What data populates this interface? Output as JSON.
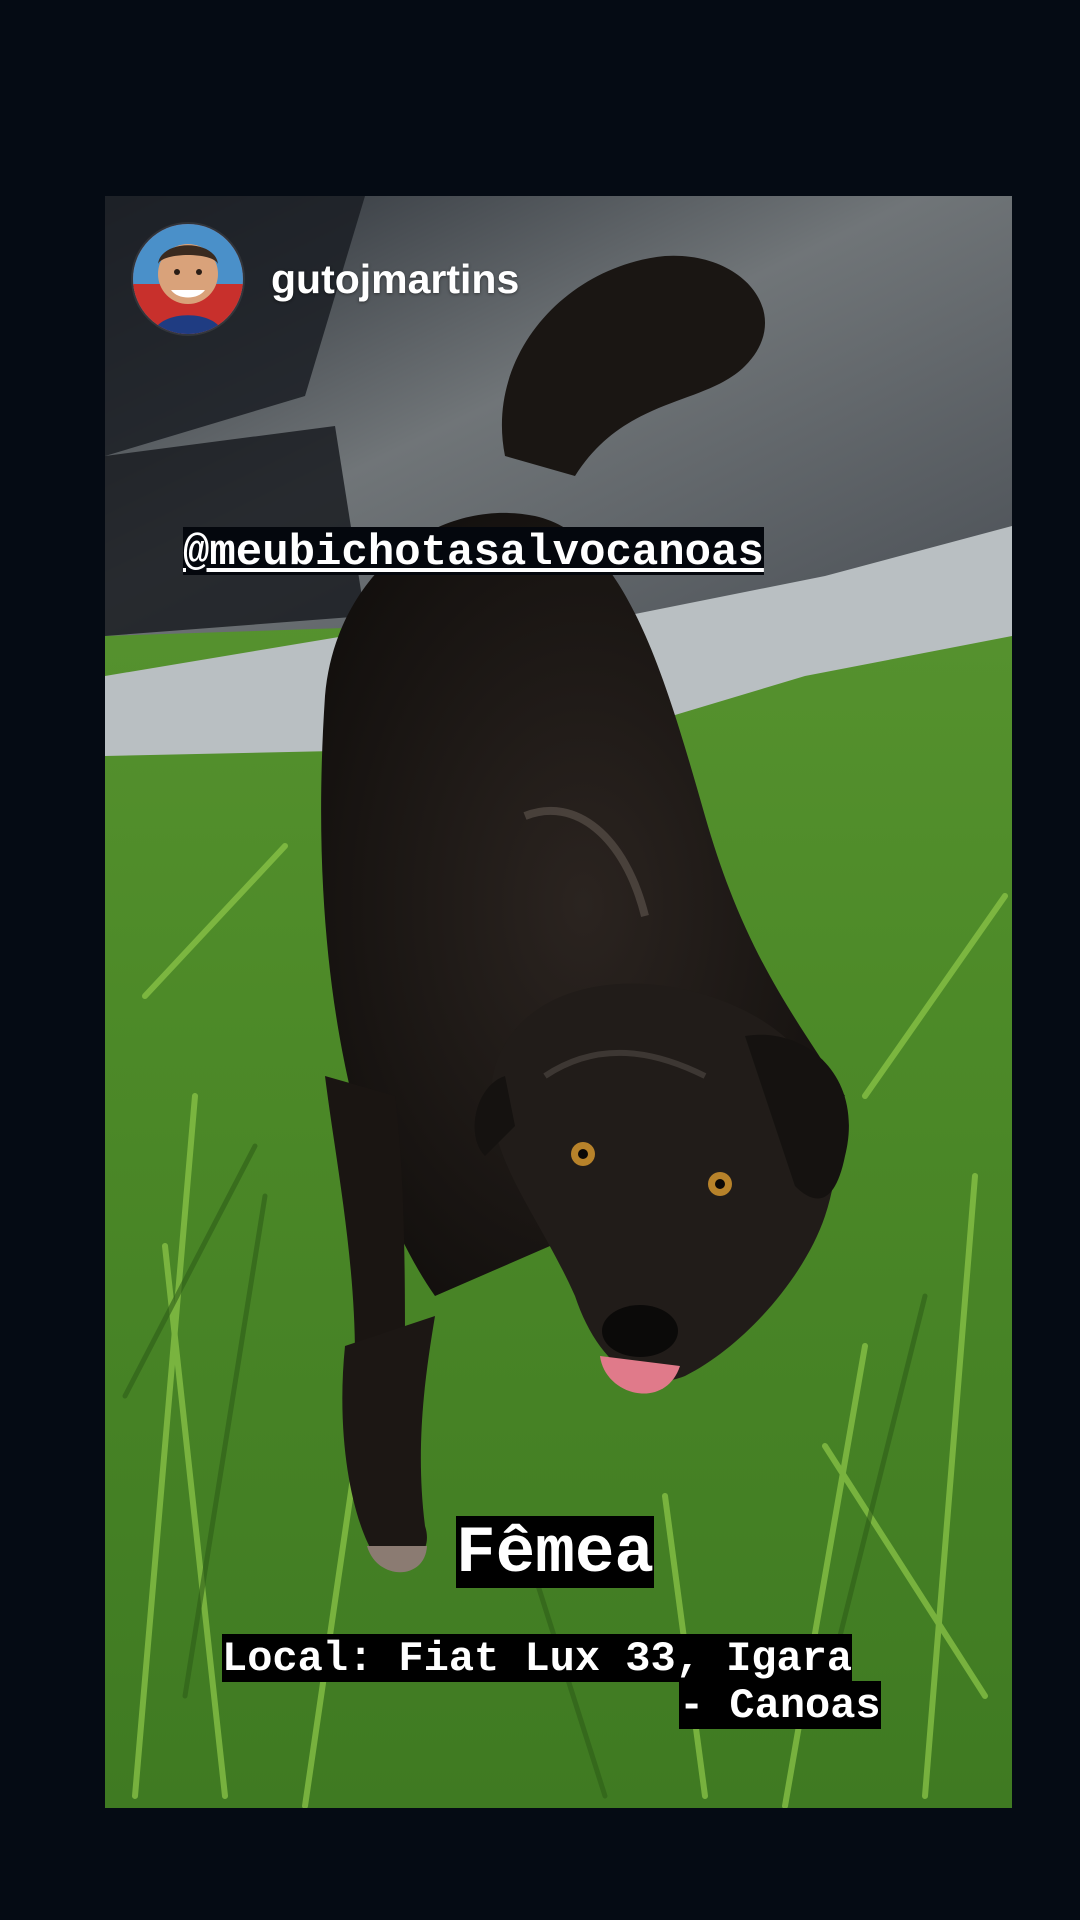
{
  "story": {
    "username": "gutojmartins",
    "mention": "@meubichotasalvocanoas",
    "caption_sex": "Fêmea",
    "caption_location_line1": "Local: Fiat Lux 33, Igara",
    "caption_location_line2": "- Canoas",
    "avatar_icon": "profile-photo",
    "photo_subject": "black-dog-on-grass"
  },
  "colors": {
    "background": "#050b14",
    "caption_bg": "#000000",
    "caption_text": "#ffffff",
    "grass": "#4f8a2a",
    "avatar_ring": "#c8302c"
  }
}
